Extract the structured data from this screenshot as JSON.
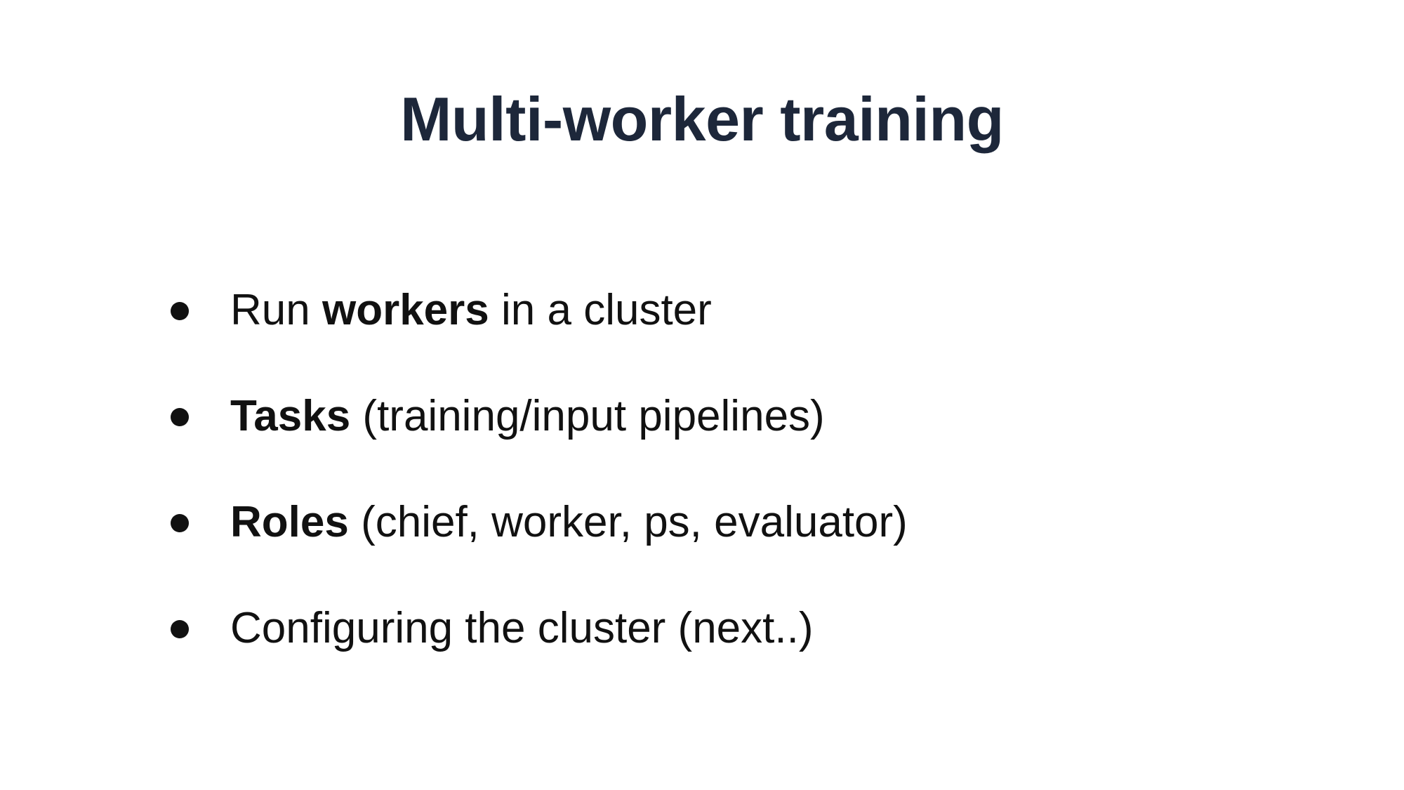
{
  "slide": {
    "title": "Multi-worker training",
    "bullets": [
      {
        "before": "Run ",
        "bold": "workers",
        "after": " in a cluster"
      },
      {
        "before": "",
        "bold": "Tasks",
        "after": " (training/input pipelines)"
      },
      {
        "before": "",
        "bold": "Roles",
        "after": " (chief, worker, ps, evaluator)"
      },
      {
        "before": "Configuring the cluster (next..)",
        "bold": "",
        "after": ""
      }
    ]
  },
  "colors": {
    "title": "#1d273a",
    "text": "#111111",
    "background": "#ffffff"
  }
}
